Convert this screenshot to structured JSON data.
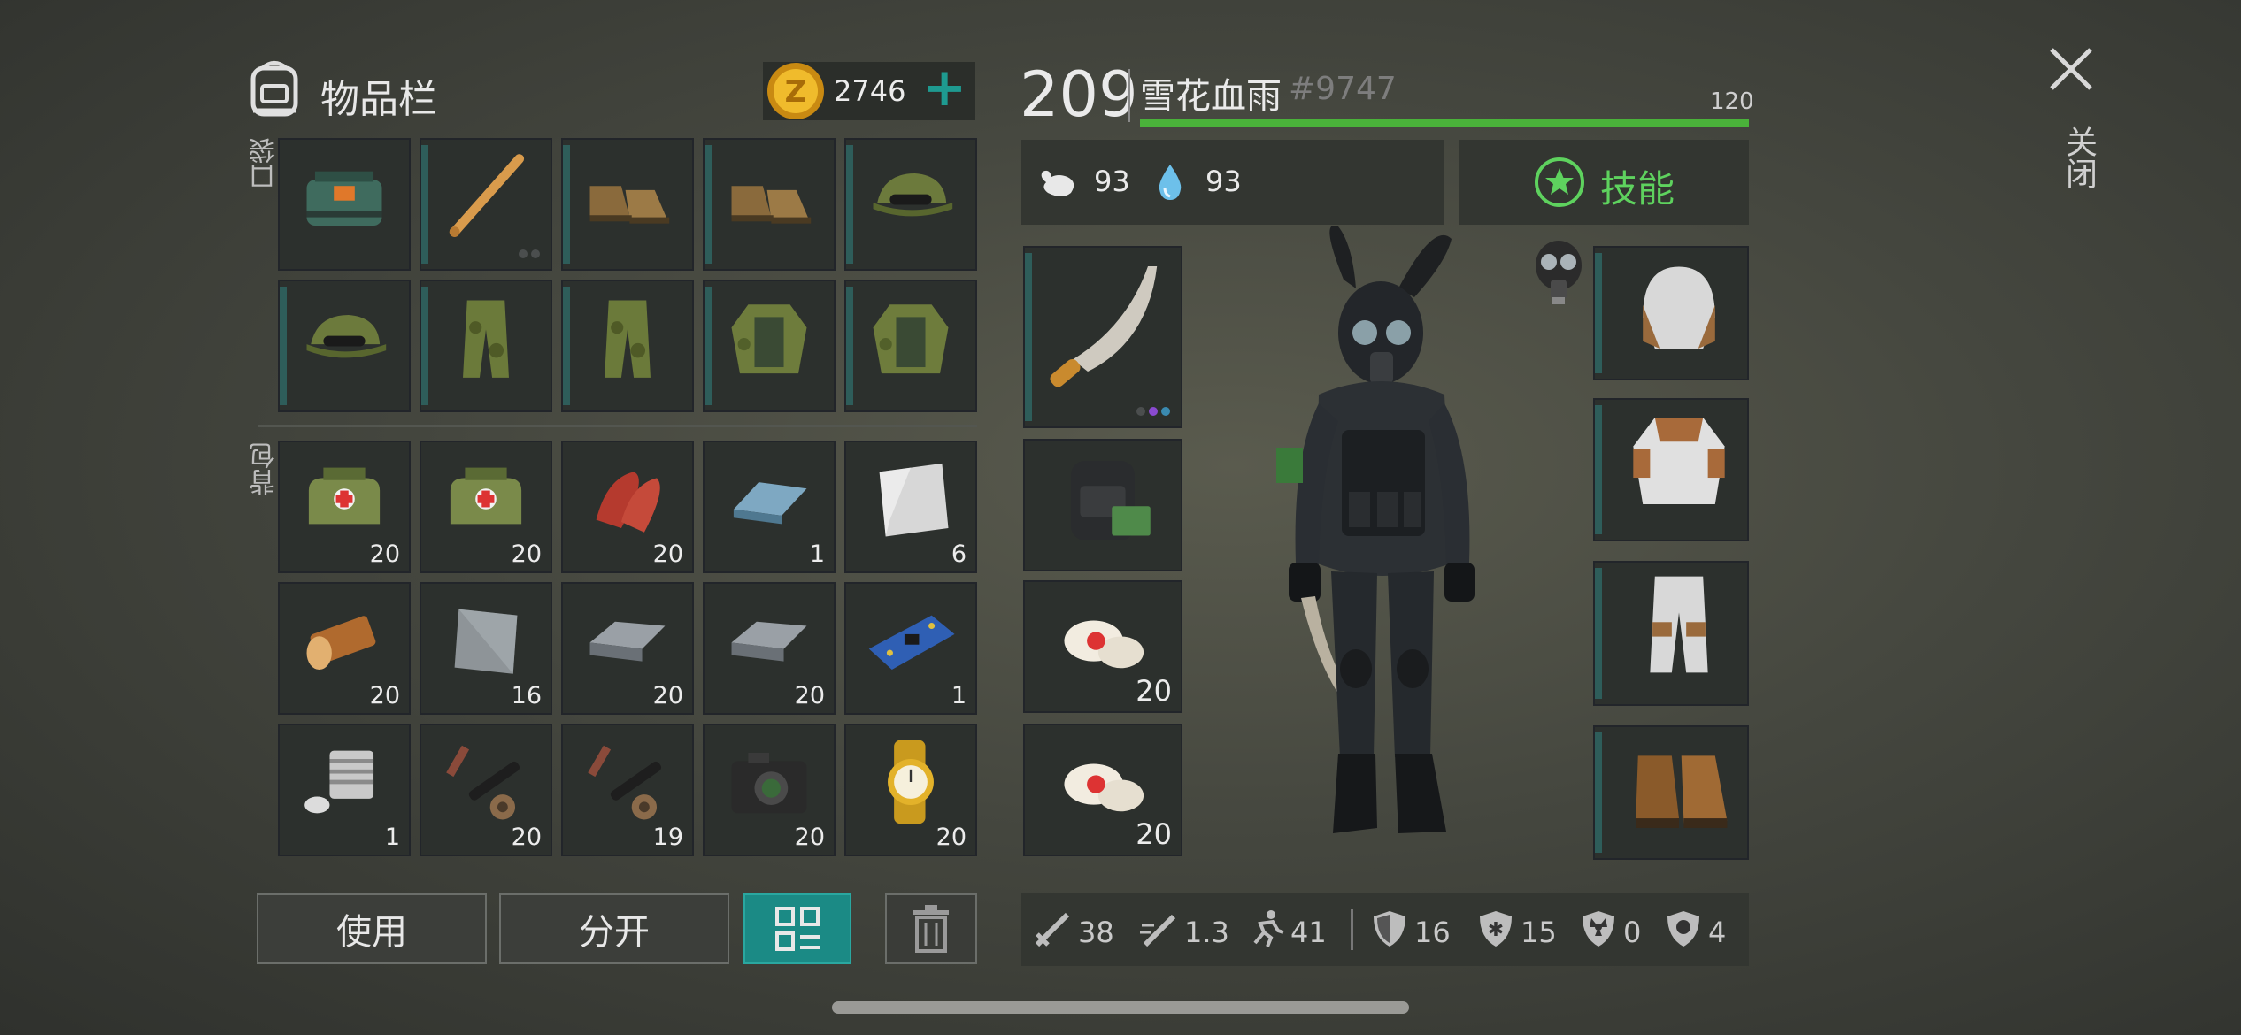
{
  "header": {
    "inventory_title": "物品栏",
    "coins": "2746",
    "add_symbol": "+",
    "close_label": "关闭"
  },
  "sections": {
    "pockets_label": "口袋",
    "backpack_label": "背包"
  },
  "pockets": [
    {
      "icon": "explosive-pack-icon",
      "count": ""
    },
    {
      "icon": "baseball-bat-icon",
      "count": ""
    },
    {
      "icon": "boots-icon",
      "count": ""
    },
    {
      "icon": "boots-icon",
      "count": ""
    },
    {
      "icon": "camo-cap-icon",
      "count": ""
    },
    {
      "icon": "camo-cap-icon",
      "count": ""
    },
    {
      "icon": "camo-pants-icon",
      "count": ""
    },
    {
      "icon": "camo-pants-icon",
      "count": ""
    },
    {
      "icon": "camo-jacket-icon",
      "count": ""
    },
    {
      "icon": "camo-jacket-icon",
      "count": ""
    }
  ],
  "backpack": [
    {
      "icon": "medkit-bag-icon",
      "count": "20"
    },
    {
      "icon": "medkit-bag-icon",
      "count": "20"
    },
    {
      "icon": "raw-meat-icon",
      "count": "20"
    },
    {
      "icon": "iron-bar-icon",
      "count": "1"
    },
    {
      "icon": "steel-plate-icon",
      "count": "6"
    },
    {
      "icon": "log-icon",
      "count": "20"
    },
    {
      "icon": "iron-plate-icon",
      "count": "16"
    },
    {
      "icon": "iron-ingot-icon",
      "count": "20"
    },
    {
      "icon": "iron-ingot-icon",
      "count": "20"
    },
    {
      "icon": "circuit-board-icon",
      "count": "1"
    },
    {
      "icon": "engine-cylinder-icon",
      "count": "1"
    },
    {
      "icon": "scope-parts-icon",
      "count": "20"
    },
    {
      "icon": "scope-parts-icon",
      "count": "19"
    },
    {
      "icon": "camera-icon",
      "count": "20"
    },
    {
      "icon": "gold-watch-icon",
      "count": "20"
    }
  ],
  "buttons": {
    "use": "使用",
    "split": "分开"
  },
  "player": {
    "level": "209",
    "name": "雪花血雨",
    "tag": "#9747",
    "xp_max": "120",
    "xp_fraction": 1.0,
    "hunger": "93",
    "thirst": "93",
    "skills_label": "技能"
  },
  "equip_left": [
    {
      "icon": "machete-icon",
      "count": ""
    },
    {
      "icon": "backpack-icon",
      "count": ""
    },
    {
      "icon": "bandage-icon",
      "count": "20"
    },
    {
      "icon": "bandage-icon",
      "count": "20"
    }
  ],
  "equip_right": [
    {
      "icon": "aviator-hat-icon"
    },
    {
      "icon": "armored-jacket-icon"
    },
    {
      "icon": "armored-pants-icon"
    },
    {
      "icon": "leather-boots-icon"
    }
  ],
  "stats": [
    {
      "icon": "sword-icon",
      "value": "38"
    },
    {
      "icon": "attack-speed-icon",
      "value": "1.3"
    },
    {
      "icon": "run-speed-icon",
      "value": "41"
    },
    {
      "icon": "armor-shield-icon",
      "value": "16"
    },
    {
      "icon": "cold-resist-icon",
      "value": "15"
    },
    {
      "icon": "radiation-resist-icon",
      "value": "0"
    },
    {
      "icon": "infection-resist-icon",
      "value": "4"
    }
  ],
  "colors": {
    "accent_teal": "#1e8f8a",
    "xp_green": "#4ab23a",
    "skill_green": "#5ed25e",
    "coin_gold": "#e0a81c"
  }
}
